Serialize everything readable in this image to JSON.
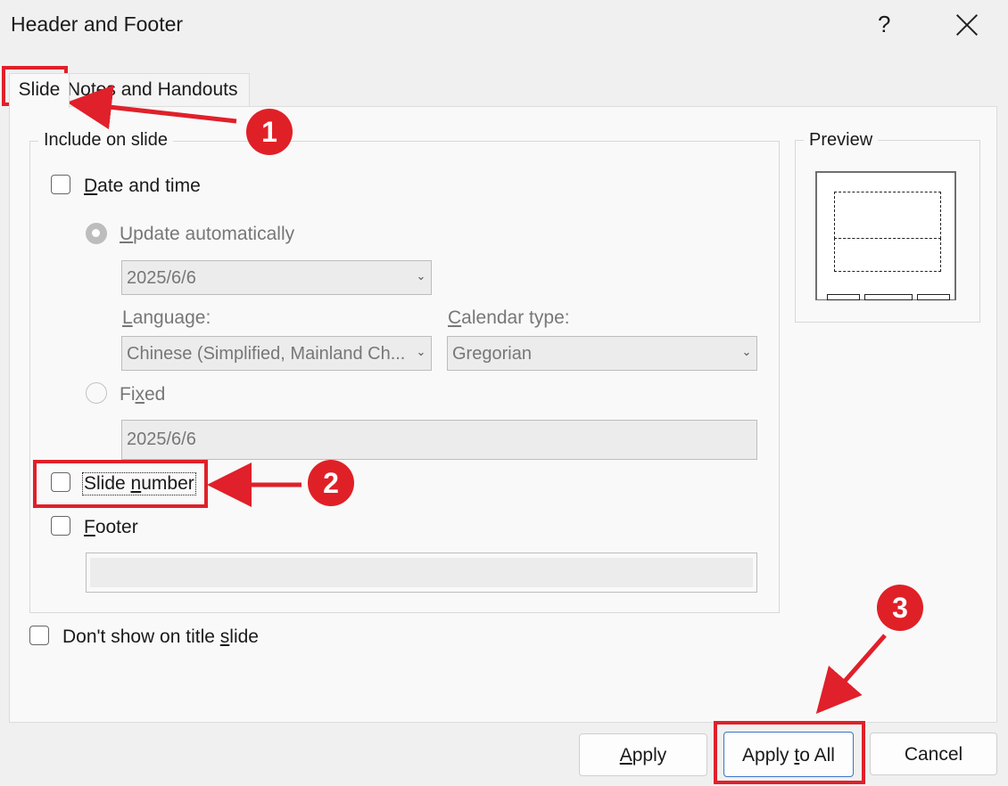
{
  "dialog": {
    "title": "Header and Footer",
    "help": "?"
  },
  "tabs": [
    {
      "label": "Slide"
    },
    {
      "label": "Notes and Handouts"
    }
  ],
  "include_group": {
    "legend": "Include on slide",
    "date_time": {
      "label_pre": "",
      "label_ul": "D",
      "label_post": "ate and time",
      "update_auto": {
        "label_ul": "U",
        "label_post": "pdate automatically"
      },
      "date_value": "2025/6/6",
      "language_label": {
        "ul": "L",
        "post": "anguage:"
      },
      "language_value": "Chinese (Simplified, Mainland Ch...",
      "calendar_label": {
        "ul": "C",
        "post": "alendar type:"
      },
      "calendar_value": "Gregorian",
      "fixed": {
        "pre": "Fi",
        "ul": "x",
        "post": "ed"
      },
      "fixed_value": "2025/6/6"
    },
    "slide_number": {
      "pre": "Slide ",
      "ul": "n",
      "post": "umber"
    },
    "footer": {
      "ul": "F",
      "post": "ooter"
    }
  },
  "dont_show": {
    "pre": "Don't show on title ",
    "ul": "s",
    "post": "lide"
  },
  "preview": {
    "legend": "Preview"
  },
  "buttons": {
    "apply": {
      "ul": "A",
      "post": "pply"
    },
    "apply_all": {
      "pre": "Apply ",
      "ul": "t",
      "post": "o All"
    },
    "cancel": "Cancel"
  },
  "annotations": {
    "badge1": "1",
    "badge2": "2",
    "badge3": "3",
    "color": "#e0202a"
  }
}
